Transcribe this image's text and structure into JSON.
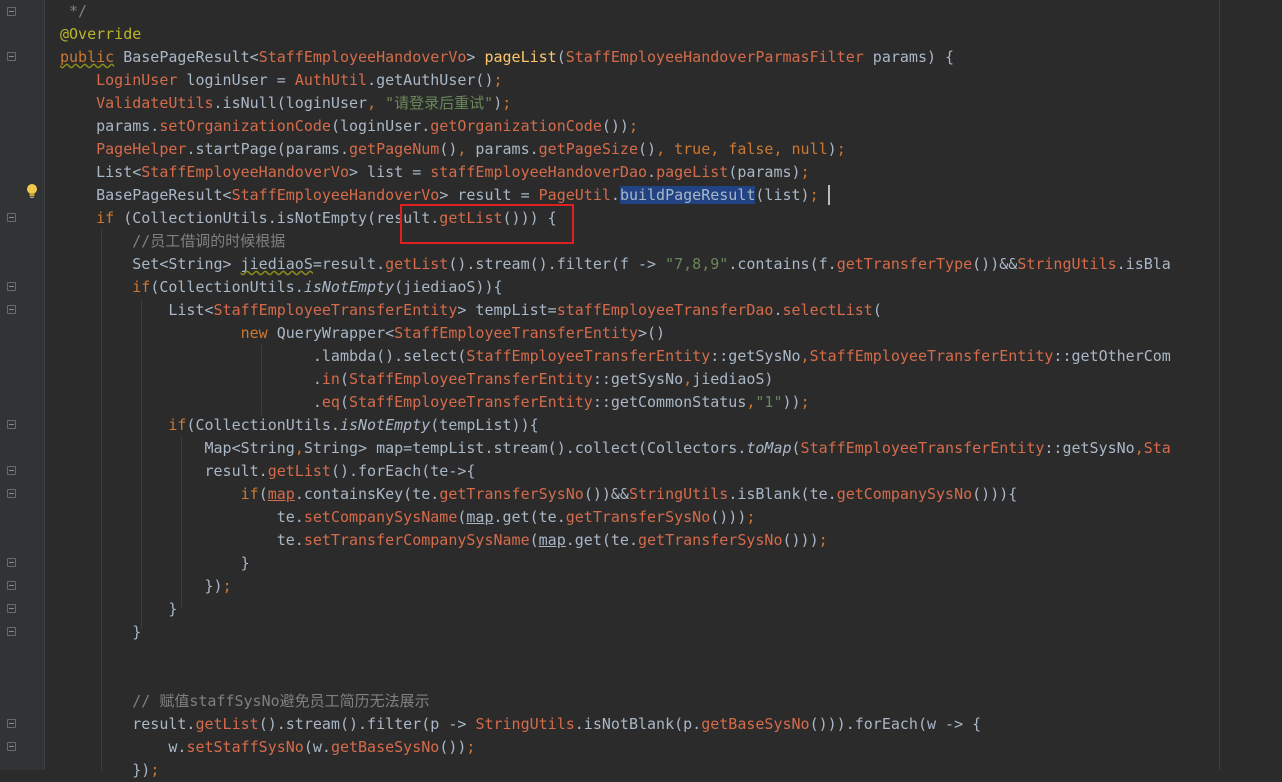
{
  "editor": {
    "theme_colors": {
      "background": "#2b2b2b",
      "gutter": "#313335",
      "keyword": "#cc7832",
      "method": "#d56b4a",
      "string": "#6a8759",
      "comment": "#808080",
      "annotation": "#bbb529",
      "selection": "#214283",
      "highlight_box": "#e02020"
    },
    "gutter_icons": [
      "fold-marker-icon",
      "lightbulb-icon"
    ],
    "lines": [
      [
        [
          "cm",
          " */"
        ]
      ],
      [
        [
          "an",
          "@Override"
        ]
      ],
      [
        [
          "kw warn",
          "public"
        ],
        [
          "t",
          " BasePageResult<"
        ],
        [
          "m",
          "StaffEmployeeHandoverVo"
        ],
        [
          "t",
          "> "
        ],
        [
          "fn",
          "pageList"
        ],
        [
          "t",
          "("
        ],
        [
          "m",
          "StaffEmployeeHandoverParmasFilter"
        ],
        [
          "t",
          " params) {"
        ]
      ],
      [
        [
          "t",
          "    "
        ],
        [
          "m",
          "LoginUser"
        ],
        [
          "t",
          " loginUser = "
        ],
        [
          "m",
          "AuthUtil"
        ],
        [
          "t",
          ".getAuthUser()"
        ],
        [
          "kw",
          ";"
        ]
      ],
      [
        [
          "t",
          "    "
        ],
        [
          "m",
          "ValidateUtils"
        ],
        [
          "t",
          ".isNull(loginUser"
        ],
        [
          "kw",
          ","
        ],
        [
          "t",
          " "
        ],
        [
          "s",
          "\"请登录后重试\""
        ],
        [
          "t",
          ")"
        ],
        [
          "kw",
          ";"
        ]
      ],
      [
        [
          "t",
          "    params."
        ],
        [
          "m",
          "setOrganizationCode"
        ],
        [
          "t",
          "(loginUser."
        ],
        [
          "m",
          "getOrganizationCode"
        ],
        [
          "t",
          "())"
        ],
        [
          "kw",
          ";"
        ]
      ],
      [
        [
          "t",
          "    "
        ],
        [
          "m",
          "PageHelper"
        ],
        [
          "t",
          ".startPage(params."
        ],
        [
          "m",
          "getPageNum"
        ],
        [
          "t",
          "()"
        ],
        [
          "kw",
          ","
        ],
        [
          "t",
          " params."
        ],
        [
          "m",
          "getPageSize"
        ],
        [
          "t",
          "()"
        ],
        [
          "kw",
          ","
        ],
        [
          "t",
          " "
        ],
        [
          "kw",
          "true"
        ],
        [
          "kw",
          ","
        ],
        [
          "t",
          " "
        ],
        [
          "kw",
          "false"
        ],
        [
          "kw",
          ","
        ],
        [
          "t",
          " "
        ],
        [
          "kw",
          "null"
        ],
        [
          "t",
          ")"
        ],
        [
          "kw",
          ";"
        ]
      ],
      [
        [
          "t",
          "    List<"
        ],
        [
          "m",
          "StaffEmployeeHandoverVo"
        ],
        [
          "t",
          "> list = "
        ],
        [
          "m",
          "staffEmployeeHandoverDao"
        ],
        [
          "t",
          "."
        ],
        [
          "m",
          "pageList"
        ],
        [
          "t",
          "(params)"
        ],
        [
          "kw",
          ";"
        ]
      ],
      [
        [
          "t",
          "    BasePageResult<"
        ],
        [
          "m",
          "StaffEmployeeHandoverVo"
        ],
        [
          "t",
          "> result = "
        ],
        [
          "m",
          "PageUtil"
        ],
        [
          "t",
          "."
        ],
        [
          "sel",
          "buildPageResult"
        ],
        [
          "t",
          "(list)"
        ],
        [
          "kw",
          ";"
        ]
      ],
      [
        [
          "t",
          "    "
        ],
        [
          "kw",
          "if"
        ],
        [
          "t",
          " (CollectionUtils.isNotEmpty(result."
        ],
        [
          "m",
          "getList"
        ],
        [
          "t",
          "())) {"
        ]
      ],
      [
        [
          "t",
          "        "
        ],
        [
          "cm",
          "//员工借调的时候根据"
        ]
      ],
      [
        [
          "t",
          "        Set<String> "
        ],
        [
          "warn",
          "jiediaoS"
        ],
        [
          "t",
          "=result."
        ],
        [
          "m",
          "getList"
        ],
        [
          "t",
          "().stream().filter(f -> "
        ],
        [
          "s",
          "\"7,8,9\""
        ],
        [
          "t",
          ".contains(f."
        ],
        [
          "m",
          "getTransferType"
        ],
        [
          "t",
          "())&&"
        ],
        [
          "m",
          "StringUtils"
        ],
        [
          "t",
          ".isBla"
        ]
      ],
      [
        [
          "t",
          "        "
        ],
        [
          "kw",
          "if"
        ],
        [
          "t",
          "(CollectionUtils."
        ],
        [
          "it",
          "isNotEmpty"
        ],
        [
          "t",
          "(jiediaoS)){"
        ]
      ],
      [
        [
          "t",
          "            List<"
        ],
        [
          "m",
          "StaffEmployeeTransferEntity"
        ],
        [
          "t",
          "> tempList="
        ],
        [
          "m",
          "staffEmployeeTransferDao"
        ],
        [
          "t",
          "."
        ],
        [
          "m",
          "selectList"
        ],
        [
          "t",
          "("
        ]
      ],
      [
        [
          "t",
          "                    "
        ],
        [
          "kw",
          "new"
        ],
        [
          "t",
          " QueryWrapper<"
        ],
        [
          "m",
          "StaffEmployeeTransferEntity"
        ],
        [
          "t",
          ">()"
        ]
      ],
      [
        [
          "t",
          "                            .lambda().select("
        ],
        [
          "m",
          "StaffEmployeeTransferEntity"
        ],
        [
          "t",
          "::getSysNo"
        ],
        [
          "kw",
          ","
        ],
        [
          "m",
          "StaffEmployeeTransferEntity"
        ],
        [
          "t",
          "::getOtherCom"
        ]
      ],
      [
        [
          "t",
          "                            ."
        ],
        [
          "m",
          "in"
        ],
        [
          "t",
          "("
        ],
        [
          "m",
          "StaffEmployeeTransferEntity"
        ],
        [
          "t",
          "::getSysNo"
        ],
        [
          "kw",
          ","
        ],
        [
          "t",
          "jiediaoS)"
        ]
      ],
      [
        [
          "t",
          "                            ."
        ],
        [
          "m",
          "eq"
        ],
        [
          "t",
          "("
        ],
        [
          "m",
          "StaffEmployeeTransferEntity"
        ],
        [
          "t",
          "::getCommonStatus"
        ],
        [
          "kw",
          ","
        ],
        [
          "s",
          "\"1\""
        ],
        [
          "t",
          "))"
        ],
        [
          "kw",
          ";"
        ]
      ],
      [
        [
          "t",
          "            "
        ],
        [
          "kw",
          "if"
        ],
        [
          "t",
          "(CollectionUtils."
        ],
        [
          "it",
          "isNotEmpty"
        ],
        [
          "t",
          "(tempList)){"
        ]
      ],
      [
        [
          "t",
          "                Map<String"
        ],
        [
          "kw",
          ","
        ],
        [
          "t",
          "String> map=tempList.stream().collect(Collectors."
        ],
        [
          "it",
          "toMap"
        ],
        [
          "t",
          "("
        ],
        [
          "m",
          "StaffEmployeeTransferEntity"
        ],
        [
          "t",
          "::getSysNo"
        ],
        [
          "kw",
          ","
        ],
        [
          "m",
          "Sta"
        ]
      ],
      [
        [
          "t",
          "                result."
        ],
        [
          "m",
          "getList"
        ],
        [
          "t",
          "().forEach(te->{"
        ]
      ],
      [
        [
          "t",
          "                    "
        ],
        [
          "kw",
          "if"
        ],
        [
          "t",
          "("
        ],
        [
          "m ul",
          "map"
        ],
        [
          "t",
          ".containsKey(te."
        ],
        [
          "m",
          "getTransferSysNo"
        ],
        [
          "t",
          "())&&"
        ],
        [
          "m",
          "StringUtils"
        ],
        [
          "t",
          ".isBlank(te."
        ],
        [
          "m",
          "getCompanySysNo"
        ],
        [
          "t",
          "())){"
        ]
      ],
      [
        [
          "t",
          "                        te."
        ],
        [
          "m",
          "setCompanySysName"
        ],
        [
          "t",
          "("
        ],
        [
          "ul",
          "map"
        ],
        [
          "t",
          ".get(te."
        ],
        [
          "m",
          "getTransferSysNo"
        ],
        [
          "t",
          "()))"
        ],
        [
          "kw",
          ";"
        ]
      ],
      [
        [
          "t",
          "                        te."
        ],
        [
          "m",
          "setTransferCompanySysName"
        ],
        [
          "t",
          "("
        ],
        [
          "ul",
          "map"
        ],
        [
          "t",
          ".get(te."
        ],
        [
          "m",
          "getTransferSysNo"
        ],
        [
          "t",
          "()))"
        ],
        [
          "kw",
          ";"
        ]
      ],
      [
        [
          "t",
          "                    }"
        ]
      ],
      [
        [
          "t",
          "                })"
        ],
        [
          "kw",
          ";"
        ]
      ],
      [
        [
          "t",
          "            }"
        ]
      ],
      [
        [
          "t",
          "        }"
        ]
      ],
      [
        [
          "t",
          ""
        ]
      ],
      [
        [
          "t",
          ""
        ]
      ],
      [
        [
          "t",
          "        "
        ],
        [
          "cm",
          "// 赋值staffSysNo避免员工简历无法展示"
        ]
      ],
      [
        [
          "t",
          "        result."
        ],
        [
          "m",
          "getList"
        ],
        [
          "t",
          "().stream().filter(p -> "
        ],
        [
          "m",
          "StringUtils"
        ],
        [
          "t",
          ".isNotBlank(p."
        ],
        [
          "m",
          "getBaseSysNo"
        ],
        [
          "t",
          "())).forEach(w -> {"
        ]
      ],
      [
        [
          "t",
          "            w."
        ],
        [
          "m",
          "setStaffSysNo"
        ],
        [
          "t",
          "(w."
        ],
        [
          "m",
          "getBaseSysNo"
        ],
        [
          "t",
          "())"
        ],
        [
          "kw",
          ";"
        ]
      ],
      [
        [
          "t",
          "        })"
        ],
        [
          "kw",
          ";"
        ]
      ]
    ]
  }
}
